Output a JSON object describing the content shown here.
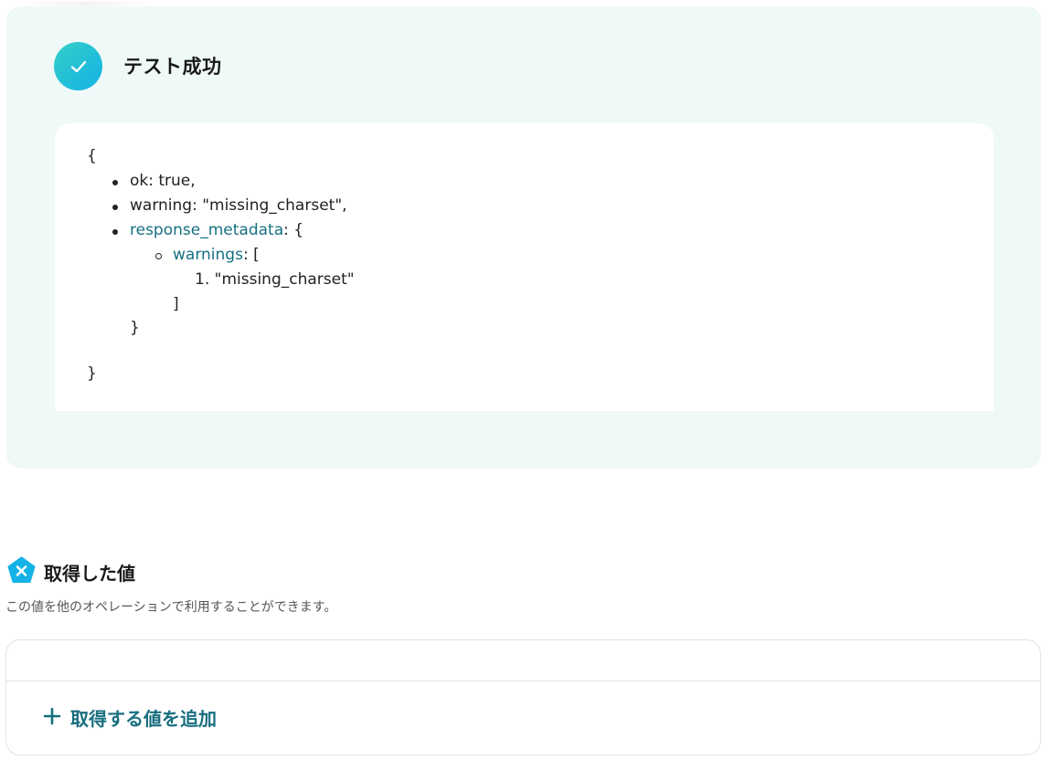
{
  "result": {
    "title": "テスト成功",
    "json_lines": {
      "open_brace": "{",
      "ok": "ok: true,",
      "warning": "warning: \"missing_charset\",",
      "response_metadata_key": "response_metadata",
      "response_metadata_rest": ": {",
      "warnings_key": "warnings",
      "warnings_rest": ": [",
      "warnings_item": "1. \"missing_charset\"",
      "close_bracket": "]",
      "close_inner_brace": "}",
      "close_brace": "}"
    }
  },
  "obtained_values": {
    "title": "取得した値",
    "description": "この値を他のオペレーションで利用することができます。",
    "add_button_label": "取得する値を追加"
  },
  "colors": {
    "panel_bg": "#eff9f8",
    "accent_teal": "#176e7f",
    "check_gradient_start": "#35cfc6",
    "check_gradient_end": "#14b2e6",
    "icon_blue": "#14b2e6"
  },
  "icons": {
    "success": "check-icon",
    "section": "variable-x-icon",
    "add": "plus-icon"
  }
}
